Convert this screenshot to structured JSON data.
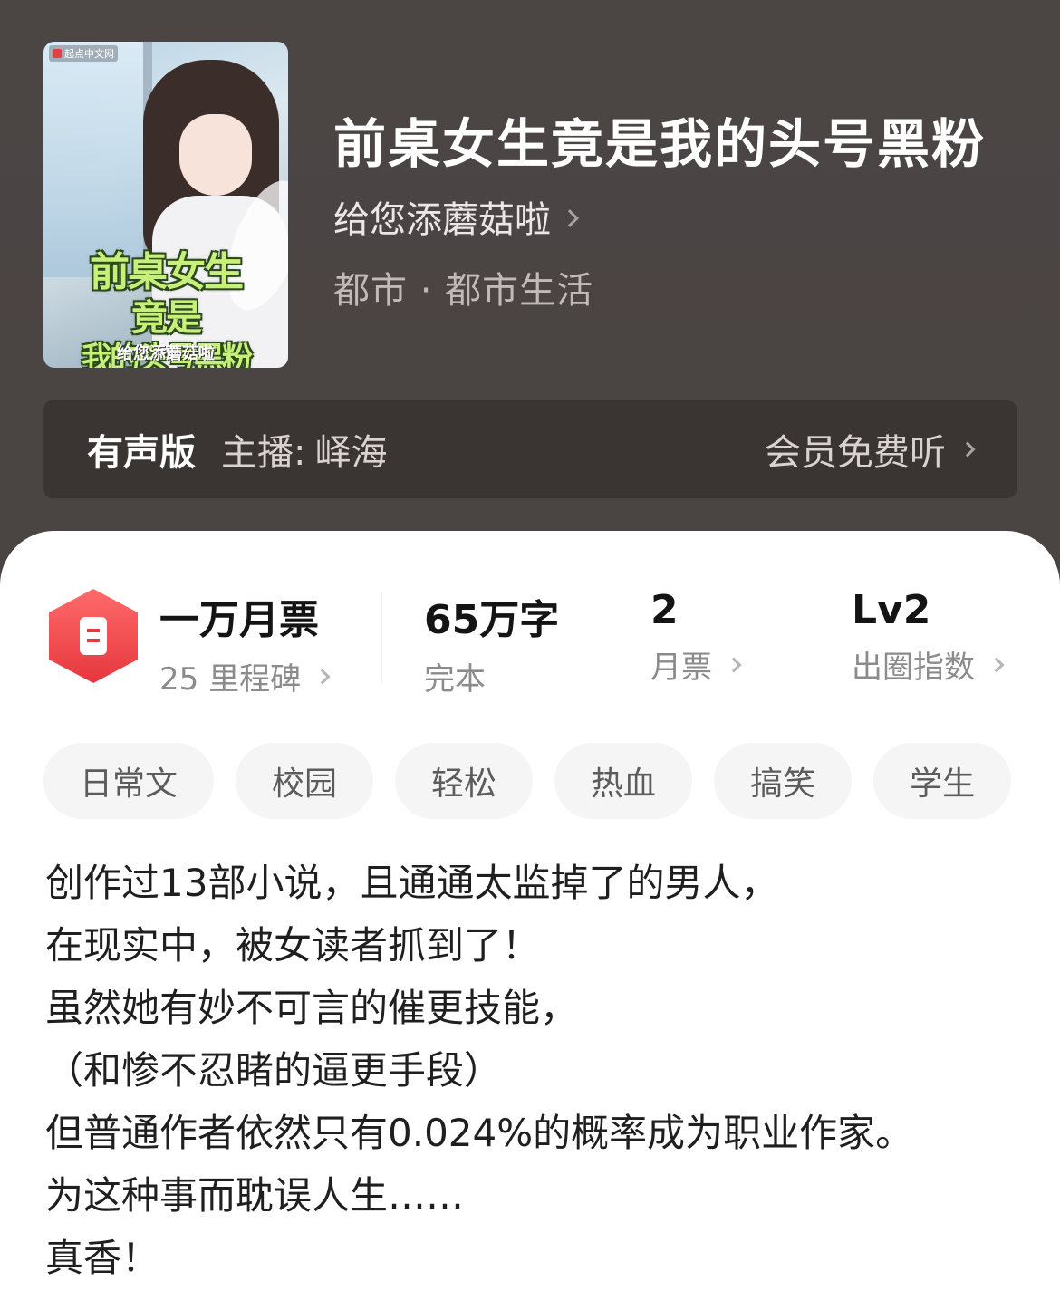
{
  "book": {
    "cover": {
      "publisher_logo": "起点中文网",
      "title_line1": "前桌女生",
      "title_line2": "竟是",
      "title_line3": "我的头号黑粉",
      "author": "给您添蘑菇啦"
    },
    "title": "前桌女生竟是我的头号黑粉",
    "author": "给您添蘑菇啦",
    "category": "都市 · 都市生活"
  },
  "audio": {
    "label": "有声版",
    "narrator_prefix": "主播:",
    "narrator": "峄海",
    "cta": "会员免费听"
  },
  "stats": {
    "milestone_title": "一万月票",
    "milestone_sub": "25 里程碑",
    "words_num": "65",
    "words_unit": "万字",
    "words_status": "完本",
    "monthly_tickets": "2",
    "monthly_tickets_label": "月票",
    "level": "Lv2",
    "level_label": "出圈指数"
  },
  "tags": [
    "日常文",
    "校园",
    "轻松",
    "热血",
    "搞笑",
    "学生"
  ],
  "synopsis": [
    "创作过13部小说，且通通太监掉了的男人，",
    "在现实中，被女读者抓到了！",
    "虽然她有妙不可言的催更技能，",
    "（和惨不忍睹的逼更手段）",
    "但普通作者依然只有0.024%的概率成为职业作家。",
    "为这种事而耽误人生……",
    "真香！"
  ],
  "colors": {
    "header_bg": "#4b4544",
    "audio_bar_bg": "#3a3433",
    "badge_red": "#e6373d",
    "tag_bg": "#f5f5f5"
  }
}
